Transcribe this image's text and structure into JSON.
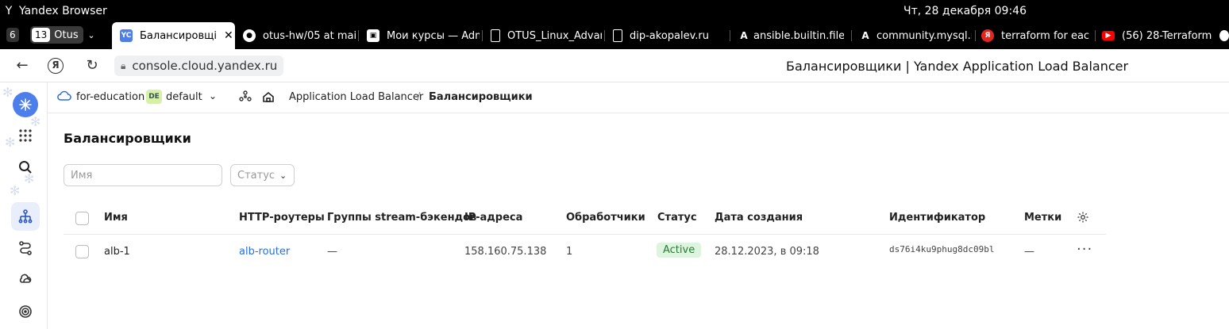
{
  "os": {
    "app_name": "Yandex Browser",
    "clock": "Чт, 28 декабря  09:46"
  },
  "tabs": {
    "count_a": "6",
    "count_b": "13",
    "group_label": "Otus",
    "items": [
      {
        "label": "Балансировщі",
        "fav": "YC",
        "active": true
      },
      {
        "label": "otus-hw/05 at mai"
      },
      {
        "label": "Мои курсы — Adm"
      },
      {
        "label": "OTUS_Linux_Advan"
      },
      {
        "label": "dip-akopalev.ru"
      },
      {
        "label": "ansible.builtin.file"
      },
      {
        "label": "community.mysql.r"
      },
      {
        "label": "terraform for each"
      },
      {
        "label": "(56) 28-Terraform"
      }
    ]
  },
  "address": {
    "url": "console.cloud.yandex.ru",
    "page_title": "Балансировщики | Yandex Application Load Balancer"
  },
  "breadcrumbs": {
    "cloud": "for-education",
    "folder_badge": "DE",
    "folder": "default",
    "service": "Application Load Balancer",
    "separator": "/",
    "current": "Балансировщики"
  },
  "main": {
    "title": "Балансировщики",
    "filter_name_placeholder": "Имя",
    "filter_status_placeholder": "Статус"
  },
  "table": {
    "columns": [
      "Имя",
      "HTTP-роутеры",
      "Группы stream-бэкендов",
      "IP-адреса",
      "Обработчики",
      "Статус",
      "Дата создания",
      "Идентификатор",
      "Метки"
    ],
    "rows": [
      {
        "name": "alb-1",
        "http_router": "alb-router",
        "stream_groups": "—",
        "ip": "158.160.75.138",
        "listeners": "1",
        "status": "Active",
        "created": "28.12.2023, в 09:18",
        "id": "ds76i4ku9phug8dc09bl",
        "labels": "—",
        "actions": "···"
      }
    ]
  },
  "colors": {
    "accent": "#4d7fec",
    "link": "#2a6fdb",
    "status_active_bg": "#ddf5de",
    "status_active_text": "#2b7a37"
  }
}
